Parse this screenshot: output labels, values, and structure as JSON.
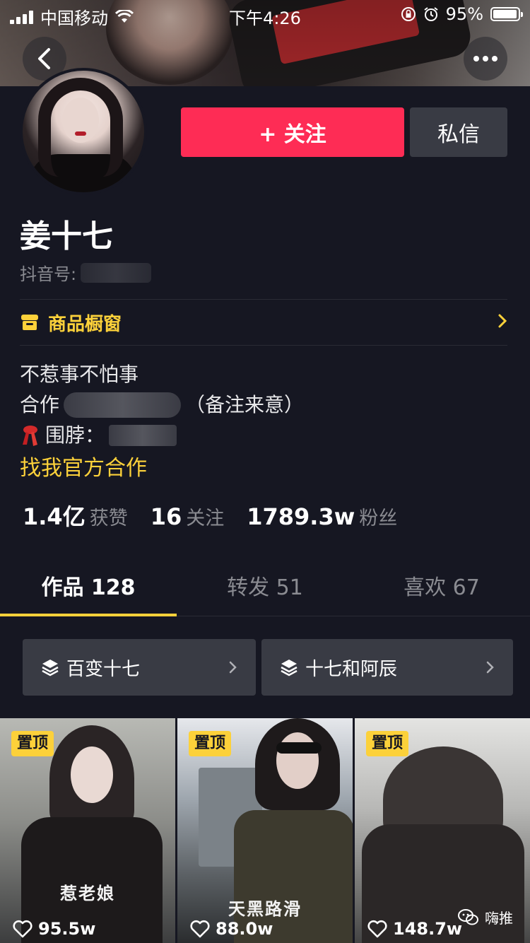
{
  "status_bar": {
    "carrier": "中国移动",
    "time": "下午4:26",
    "battery": "95%"
  },
  "profile": {
    "nickname": "姜十七",
    "douyin_id_label": "抖音号:",
    "follow_label": "+ 关注",
    "message_label": "私信"
  },
  "shop": {
    "label": "商品橱窗"
  },
  "bio": {
    "line1": "不惹事不怕事",
    "line2_prefix": "合作",
    "line2_suffix": "（备注来意）",
    "line3_prefix": "围脖：",
    "link": "找我官方合作"
  },
  "stats": [
    {
      "value": "1.4亿",
      "label": "获赞"
    },
    {
      "value": "16",
      "label": "关注"
    },
    {
      "value": "1789.3w",
      "label": "粉丝"
    }
  ],
  "tabs": [
    {
      "label": "作品 128"
    },
    {
      "label": "转发 51"
    },
    {
      "label": "喜欢 67"
    }
  ],
  "collections": [
    {
      "title": "百变十七"
    },
    {
      "title": "十七和阿辰"
    }
  ],
  "videos": [
    {
      "badge": "置顶",
      "likes": "95.5w",
      "caption": "惹老娘"
    },
    {
      "badge": "置顶",
      "likes": "88.0w",
      "caption": "天黑路滑"
    },
    {
      "badge": "置顶",
      "likes": "148.7w",
      "caption": ""
    }
  ],
  "watermark": "嗨推",
  "colors": {
    "background": "#161722",
    "follow_button": "#fe2c55",
    "accent_yellow": "#fcd13a",
    "secondary_button": "#393b44",
    "muted_text": "#8a8b91"
  }
}
